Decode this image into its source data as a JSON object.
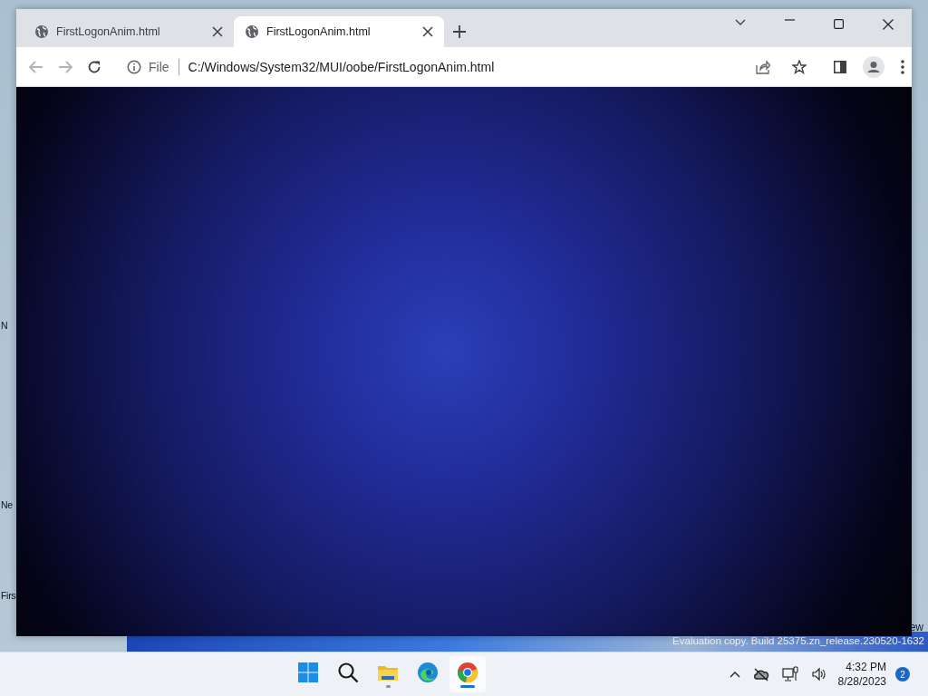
{
  "desktop": {
    "icon_labels": [
      "N",
      "Ne",
      "Firs"
    ],
    "watermark": [
      "ew",
      "Evaluation copy. Build 25375.zn_release.230520-1632"
    ]
  },
  "browser": {
    "tabs": [
      {
        "title": "FirstLogonAnim.html",
        "selected": false
      },
      {
        "title": "FirstLogonAnim.html",
        "selected": true
      }
    ],
    "address_bar": {
      "scheme": "File",
      "url": "C:/Windows/System32/MUI/oobe/FirstLogonAnim.html"
    }
  },
  "taskbar": {
    "apps": [
      {
        "kind": "start",
        "running": false,
        "selected": false
      },
      {
        "kind": "search",
        "running": false,
        "selected": false
      },
      {
        "kind": "files",
        "running": true,
        "selected": false
      },
      {
        "kind": "edge",
        "running": false,
        "selected": false
      },
      {
        "kind": "chrome",
        "running": true,
        "selected": true
      }
    ],
    "time": "4:32 PM",
    "date": "8/28/2023",
    "notifications": "2"
  }
}
